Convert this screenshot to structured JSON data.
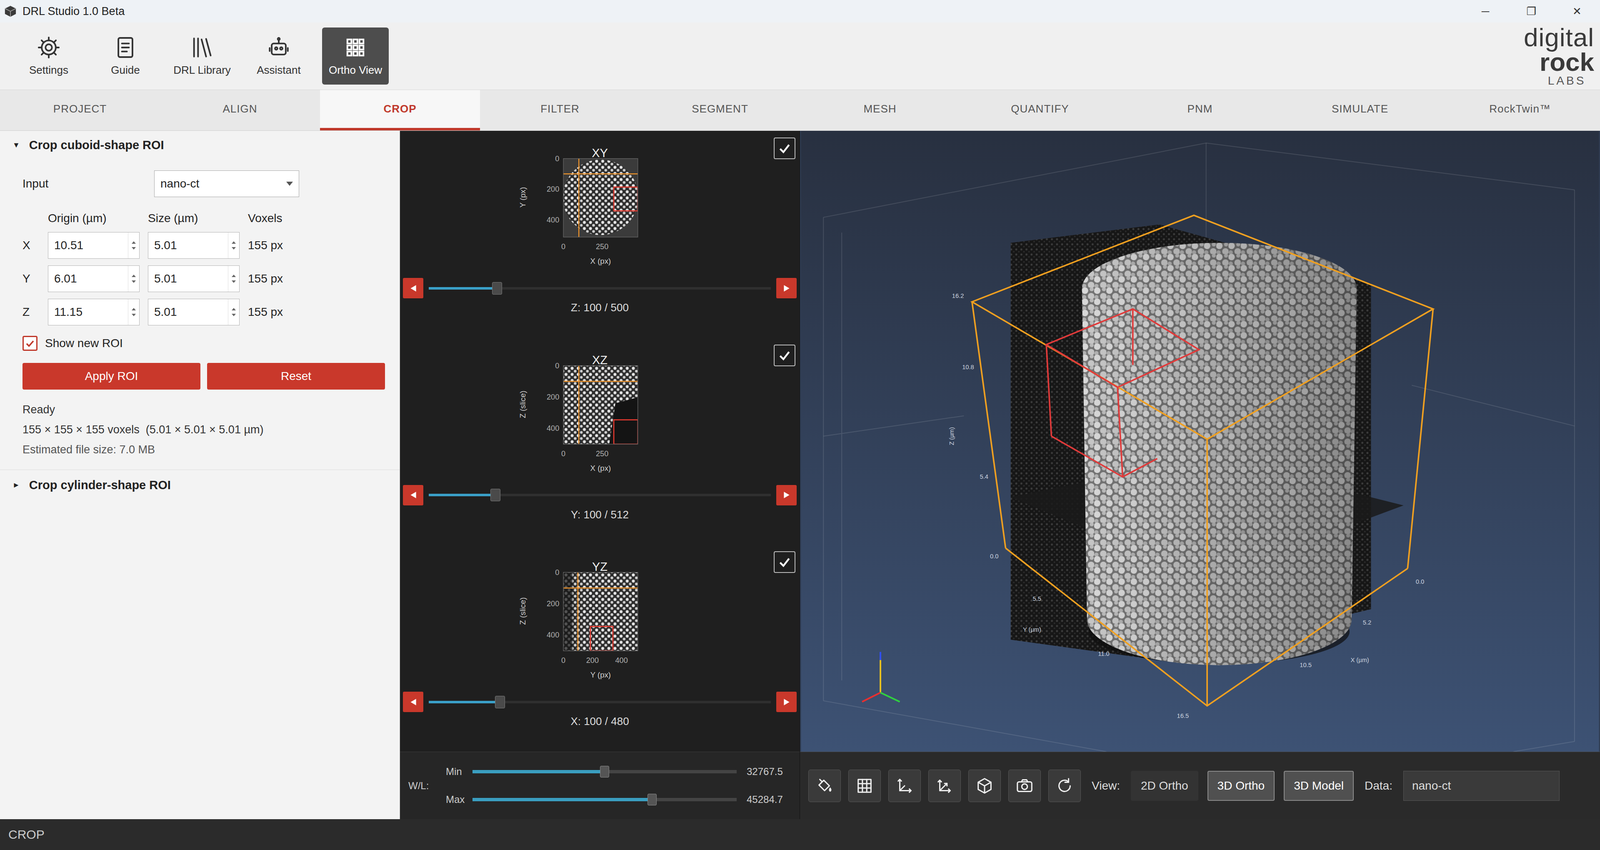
{
  "window": {
    "title": "DRL Studio 1.0 Beta",
    "controls": [
      "─",
      "❐",
      "✕"
    ]
  },
  "toolbar": [
    {
      "label": "Settings",
      "selected": false
    },
    {
      "label": "Guide",
      "selected": false
    },
    {
      "label": "DRL Library",
      "selected": false
    },
    {
      "label": "Assistant",
      "selected": false
    },
    {
      "label": "Ortho View",
      "selected": true
    }
  ],
  "logo": {
    "top": "digital",
    "middle": "rock",
    "bottom": "LABS"
  },
  "tabs": [
    {
      "label": "PROJECT",
      "selected": false
    },
    {
      "label": "ALIGN",
      "selected": false
    },
    {
      "label": "CROP",
      "selected": true
    },
    {
      "label": "FILTER",
      "selected": false
    },
    {
      "label": "SEGMENT",
      "selected": false
    },
    {
      "label": "MESH",
      "selected": false
    },
    {
      "label": "QUANTIFY",
      "selected": false
    },
    {
      "label": "PNM",
      "selected": false
    },
    {
      "label": "SIMULATE",
      "selected": false
    },
    {
      "label": "RockTwin™",
      "selected": false
    }
  ],
  "crop_cuboid": {
    "arrow": "▼",
    "title": "Crop cuboid-shape ROI",
    "expanded": true,
    "input": {
      "label": "Input",
      "value": "nano-ct"
    },
    "columns": [
      "Origin (µm)",
      "Size (µm)",
      "Voxels"
    ],
    "rows": [
      {
        "axis": "X",
        "origin": "10.51",
        "size": "5.01",
        "voxels": "155 px"
      },
      {
        "axis": "Y",
        "origin": "6.01",
        "size": "5.01",
        "voxels": "155 px"
      },
      {
        "axis": "Z",
        "origin": "11.15",
        "size": "5.01",
        "voxels": "155 px"
      }
    ],
    "show_roi": {
      "label": "Show new ROI",
      "checked": true
    },
    "buttons": [
      "Apply ROI",
      "Reset"
    ],
    "status": "Ready",
    "summary": "155 × 155 × 155 voxels  (5.01 × 5.01 × 5.01 µm)",
    "file_size": "Estimated file size: 7.0 MB"
  },
  "crop_cylinder": {
    "arrow": "►",
    "title": "Crop cylinder-shape ROI",
    "expanded": false
  },
  "slices": [
    {
      "title": "XY",
      "checked": true,
      "x_label": "X (px)",
      "y_label": "Y (px)",
      "x_ticks": [
        "0",
        "250"
      ],
      "y_ticks": [
        "0",
        "200",
        "400"
      ],
      "slider": {
        "label": "Z: 100 / 500",
        "level": 0.2
      }
    },
    {
      "title": "XZ",
      "checked": true,
      "x_label": "X (px)",
      "y_label": "Z (slice)",
      "x_ticks": [
        "0",
        "250"
      ],
      "y_ticks": [
        "0",
        "200",
        "400"
      ],
      "slider": {
        "label": "Y: 100 / 512",
        "level": 0.195
      }
    },
    {
      "title": "YZ",
      "checked": true,
      "x_label": "Y (px)",
      "y_label": "Z (slice)",
      "x_ticks": [
        "0",
        "200",
        "400"
      ],
      "y_ticks": [
        "0",
        "200",
        "400"
      ],
      "slider": {
        "label": "X: 100 / 480",
        "level": 0.208
      }
    }
  ],
  "window_level": {
    "label": "W/L:",
    "sliders": [
      {
        "name": "Min",
        "level": 0.5,
        "reading": "32767.5"
      },
      {
        "name": "Max",
        "level": 0.68,
        "reading": "45284.7"
      }
    ]
  },
  "viewport": {
    "axis_labels": [
      "16.2",
      "10.8",
      "5.4",
      "0.0",
      "Z (µm)",
      "5.5",
      "11.0",
      "16.5",
      "Y (µm)",
      "10.5",
      "5.2",
      "0.0",
      "X (µm)"
    ]
  },
  "view_bar": {
    "view_label": "View:",
    "views": [
      {
        "label": "2D Ortho",
        "selected": false
      },
      {
        "label": "3D Ortho",
        "selected": true
      },
      {
        "label": "3D Model",
        "selected": true
      }
    ],
    "data_label": "Data:",
    "data_value": "nano-ct"
  },
  "status_bar": {
    "text": "CROP"
  }
}
